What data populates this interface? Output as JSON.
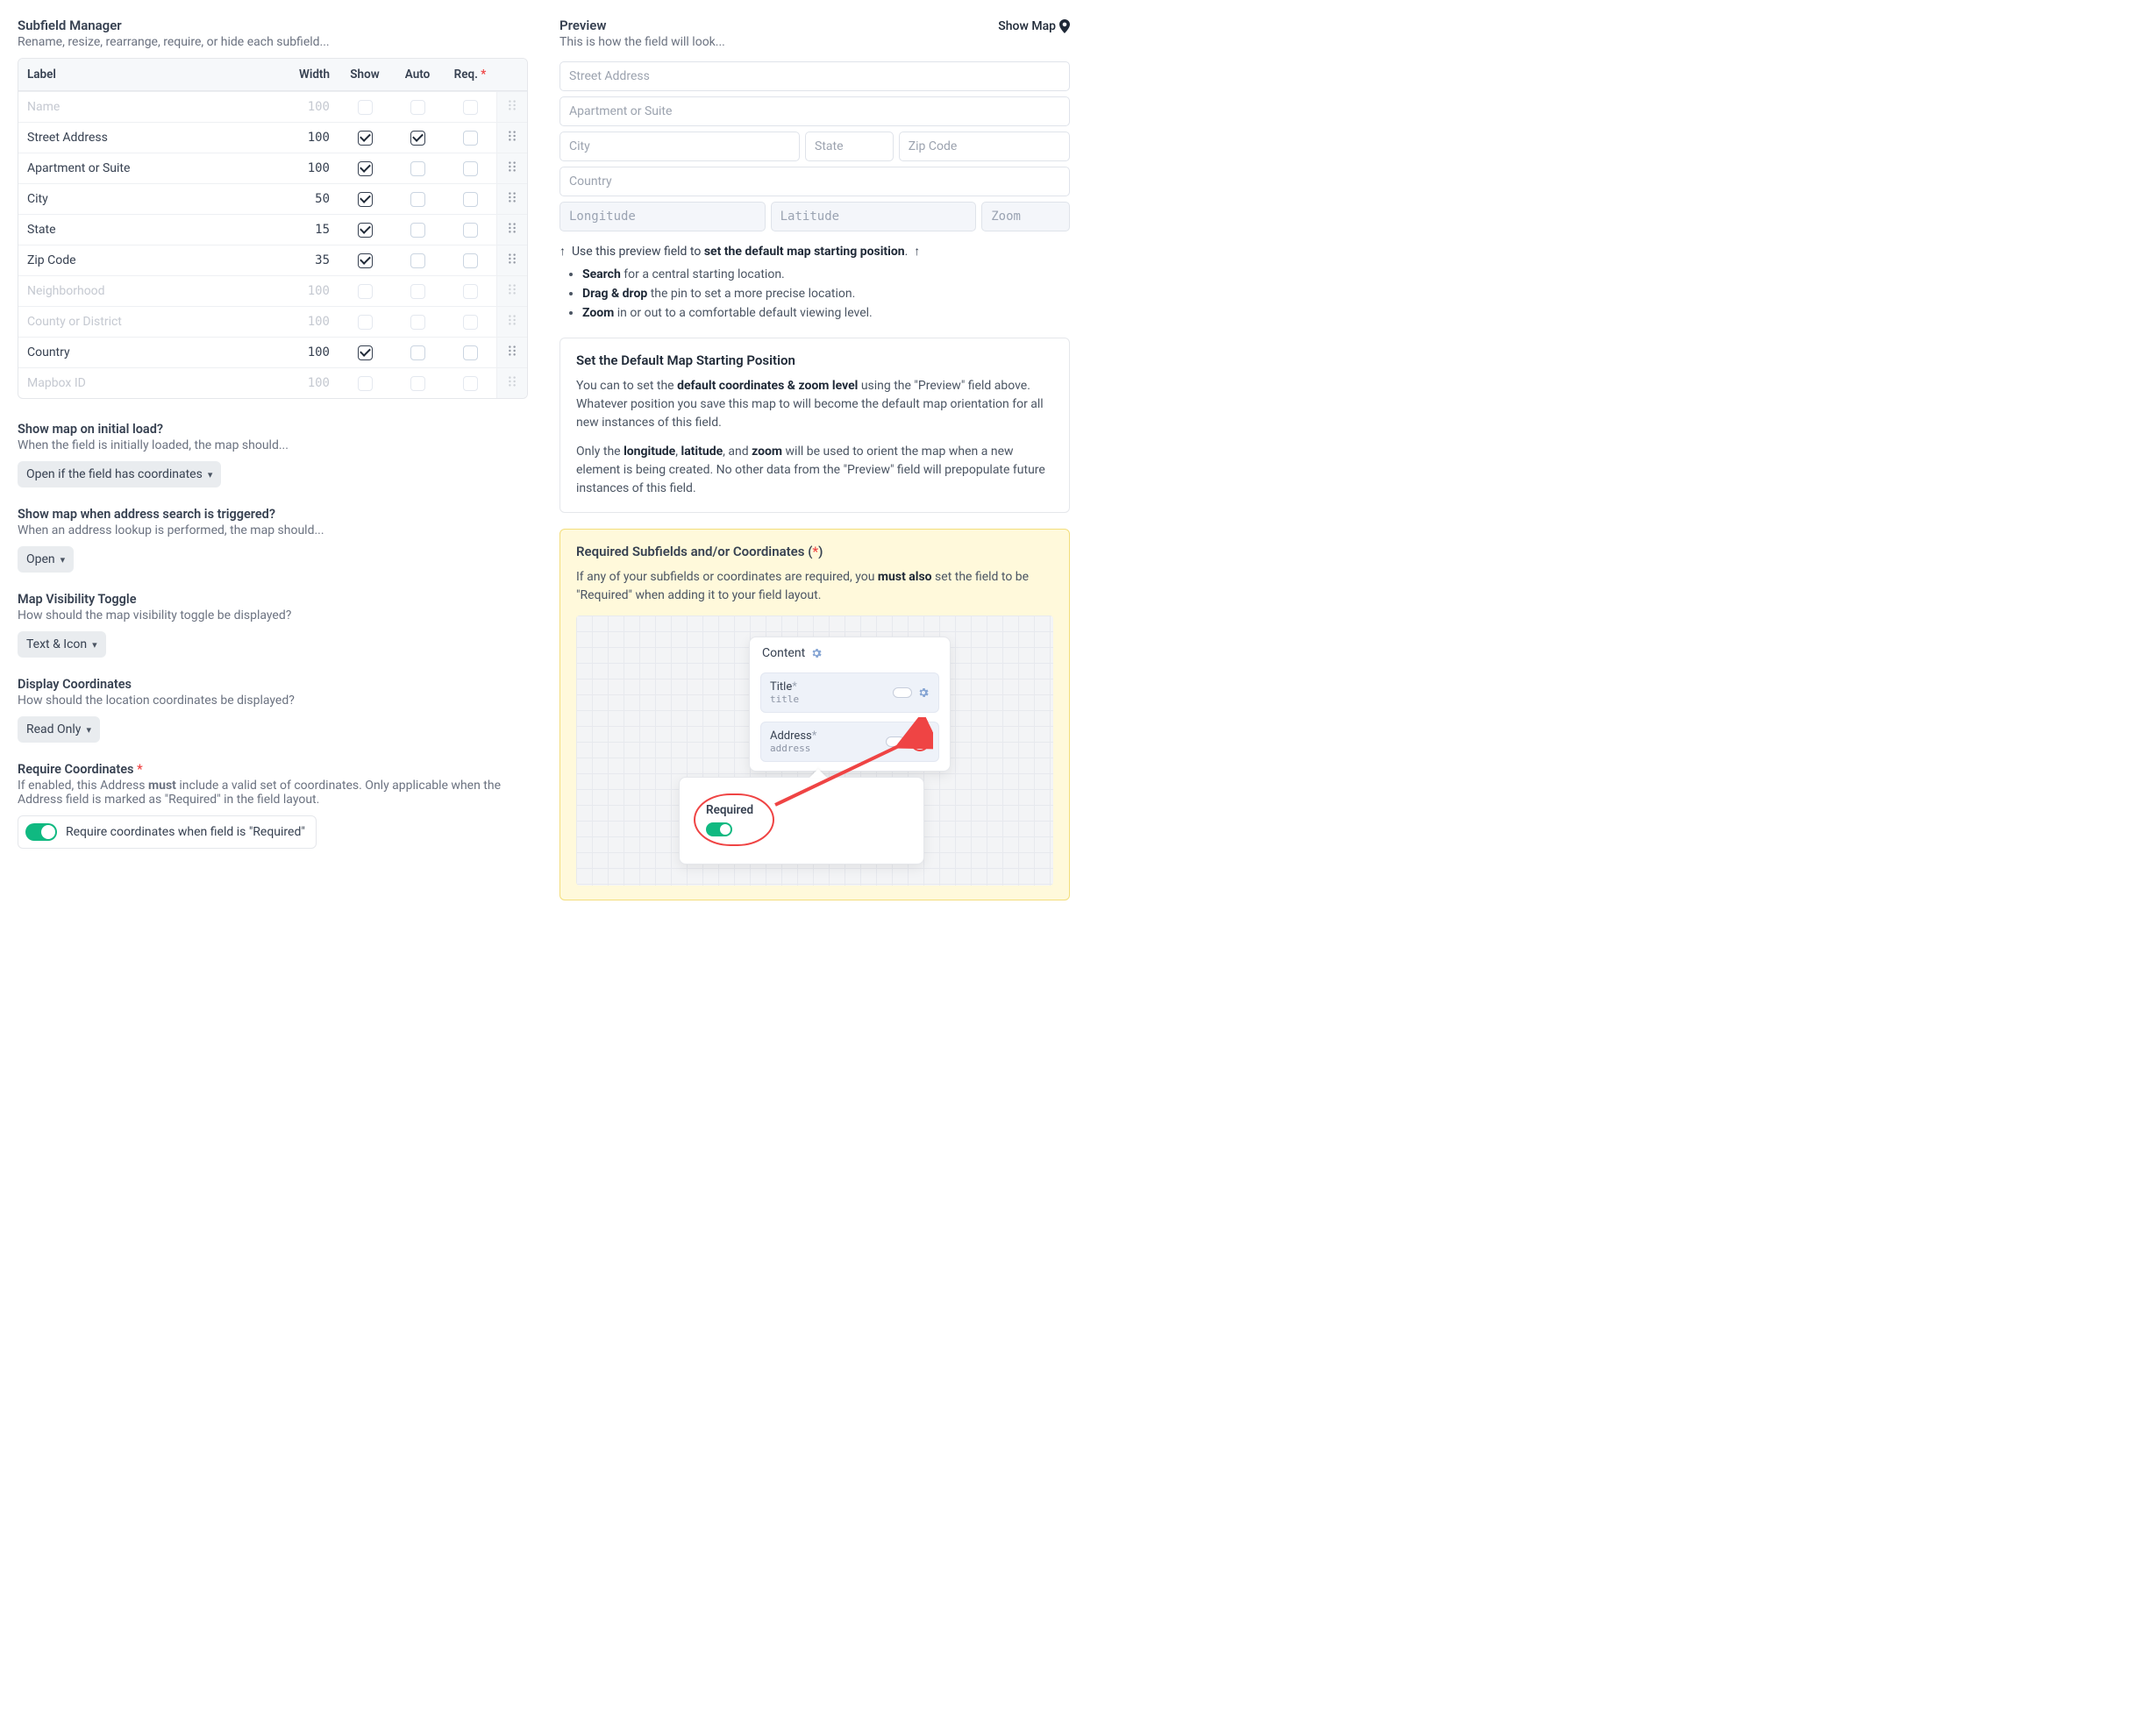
{
  "left": {
    "title": "Subfield Manager",
    "subtitle": "Rename, resize, rearrange, require, or hide each subfield...",
    "cols": {
      "label": "Label",
      "width": "Width",
      "show": "Show",
      "auto": "Auto",
      "req": "Req."
    },
    "rows": [
      {
        "label": "Name",
        "width": "100",
        "show": false,
        "auto": false,
        "req": false,
        "dim": true
      },
      {
        "label": "Street Address",
        "width": "100",
        "show": true,
        "auto": true,
        "req": false,
        "dim": false
      },
      {
        "label": "Apartment or Suite",
        "width": "100",
        "show": true,
        "auto": false,
        "req": false,
        "dim": false
      },
      {
        "label": "City",
        "width": "50",
        "show": true,
        "auto": false,
        "req": false,
        "dim": false
      },
      {
        "label": "State",
        "width": "15",
        "show": true,
        "auto": false,
        "req": false,
        "dim": false
      },
      {
        "label": "Zip Code",
        "width": "35",
        "show": true,
        "auto": false,
        "req": false,
        "dim": false
      },
      {
        "label": "Neighborhood",
        "width": "100",
        "show": false,
        "auto": false,
        "req": false,
        "dim": true
      },
      {
        "label": "County or District",
        "width": "100",
        "show": false,
        "auto": false,
        "req": false,
        "dim": true
      },
      {
        "label": "Country",
        "width": "100",
        "show": true,
        "auto": false,
        "req": false,
        "dim": false
      },
      {
        "label": "Mapbox ID",
        "width": "100",
        "show": false,
        "auto": false,
        "req": false,
        "dim": true
      }
    ],
    "settings": {
      "s1": {
        "title": "Show map on initial load?",
        "sub": "When the field is initially loaded, the map should...",
        "value": "Open if the field has coordinates"
      },
      "s2": {
        "title": "Show map when address search is triggered?",
        "sub": "When an address lookup is performed, the map should...",
        "value": "Open"
      },
      "s3": {
        "title": "Map Visibility Toggle",
        "sub": "How should the map visibility toggle be displayed?",
        "value": "Text & Icon"
      },
      "s4": {
        "title": "Display Coordinates",
        "sub": "How should the location coordinates be displayed?",
        "value": "Read Only"
      },
      "s5": {
        "title": "Require Coordinates",
        "sub_a": "If enabled, this Address ",
        "sub_b": "must",
        "sub_c": " include a valid set of coordinates. Only applicable when the Address field is marked as \"Required\" in the field layout.",
        "toggle_label": "Require coordinates when field is \"Required\""
      }
    }
  },
  "right": {
    "title": "Preview",
    "subtitle": "This is how the field will look...",
    "show_map": "Show Map",
    "placeholders": {
      "street": "Street Address",
      "apt": "Apartment or Suite",
      "city": "City",
      "state": "State",
      "zip": "Zip Code",
      "country": "Country",
      "lon": "Longitude",
      "lat": "Latitude",
      "zoom": "Zoom"
    },
    "hint_line_a": "Use this preview field to ",
    "hint_line_b": "set the default map starting position",
    "hint_line_c": ".",
    "hints": [
      {
        "b": "Search",
        "t": " for a central starting location."
      },
      {
        "b": "Drag & drop",
        "t": " the pin to set a more precise location."
      },
      {
        "b": "Zoom",
        "t": " in or out to a comfortable default viewing level."
      }
    ],
    "panel1": {
      "title": "Set the Default Map Starting Position",
      "p1a": "You can to set the ",
      "p1b": "default coordinates & zoom level",
      "p1c": " using the \"Preview\" field above. Whatever position you save this map to will become the default map orientation for all new instances of this field.",
      "p2a": "Only the ",
      "p2b": "longitude",
      "p2c": ", ",
      "p2d": "latitude",
      "p2e": ", and ",
      "p2f": "zoom",
      "p2g": " will be used to orient the map when a new element is being created. No other data from the \"Preview\" field will prepopulate future instances of this field."
    },
    "panel2": {
      "title_a": "Required Subfields and/or Coordinates (",
      "title_b": ")",
      "p_a": "If any of your subfields or coordinates are required, you ",
      "p_b": "must also",
      "p_c": " set the field to be \"Required\" when adding it to your field layout.",
      "illus": {
        "content_tab": "Content",
        "row1_t": "Title",
        "row1_h": "title",
        "row2_t": "Address",
        "row2_h": "address",
        "required": "Required"
      }
    }
  }
}
